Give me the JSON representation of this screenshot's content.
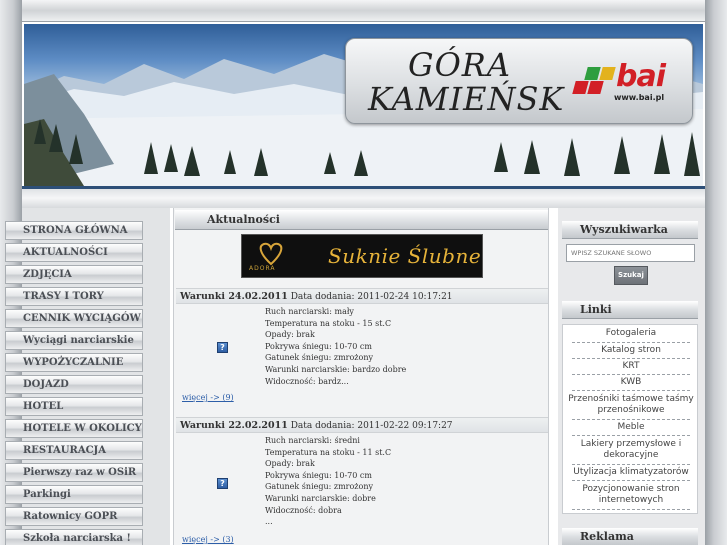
{
  "header": {
    "title_line1": "GÓRA",
    "title_line2": "KAMIEŃSK",
    "sponsor_logo": "bai",
    "sponsor_url": "www.bai.pl"
  },
  "left_menu": {
    "items": [
      "STRONA GŁÓWNA",
      "AKTUALNOŚCI",
      "ZDJĘCIA",
      "TRASY I TORY",
      "CENNIK WYCIĄGÓW",
      "Wyciągi narciarskie",
      "WYPOŻYCZALNIE",
      "DOJAZD",
      "HOTEL",
      "HOTELE W OKOLICY",
      "RESTAURACJA",
      "Pierwszy raz w OSiR",
      "Parkingi",
      "Ratownicy GOPR",
      "Szkoła narciarska !"
    ]
  },
  "news": {
    "heading": "Aktualności",
    "ad": {
      "brand": "ADORA",
      "text": "Suknie Ślubne"
    },
    "reports": [
      {
        "title": "Warunki 24.02.2011",
        "date_label": "Data dodania: 2011-02-24 10:17:21",
        "lines": [
          "Ruch narciarski: mały",
          "Temperatura na stoku - 15 st.C",
          "Opady: brak",
          "Pokrywa śniegu: 10-70 cm",
          "Gatunek śniegu: zmrożony",
          "Warunki narciarskie: bardzo dobre",
          "Widoczność: bardz..."
        ],
        "more": "więcej -> (9)"
      },
      {
        "title": "Warunki 22.02.2011",
        "date_label": "Data dodania: 2011-02-22 09:17:27",
        "lines": [
          "Ruch narciarski: średni",
          "Temperatura na stoku - 11 st.C",
          "Opady: brak",
          "Pokrywa śniegu: 10-70 cm",
          "Gatunek śniegu: zmrożony",
          "Warunki narciarskie: dobre",
          "Widoczność: dobra",
          "..."
        ],
        "more": "więcej -> (3)"
      }
    ],
    "icon_glyph": "?"
  },
  "search": {
    "heading": "Wyszukiwarka",
    "placeholder": "WPISZ SZUKANE SŁOWO",
    "button": "Szukaj"
  },
  "links": {
    "heading": "Linki",
    "items": [
      "Fotogaleria",
      "Katalog stron",
      "KRT",
      "KWB",
      "Przenośniki taśmowe taśmy przenośnikowe",
      "Meble",
      "Lakiery przemysłowe i dekoracyjne",
      "Utylizacja klimatyzatorów",
      "Pozycjonowanie stron internetowych"
    ]
  },
  "ads_section": {
    "heading": "Reklama"
  },
  "colors": {
    "accent_blue": "#2d4f78",
    "link": "#2d5ea8",
    "brand_red": "#d21f26"
  }
}
